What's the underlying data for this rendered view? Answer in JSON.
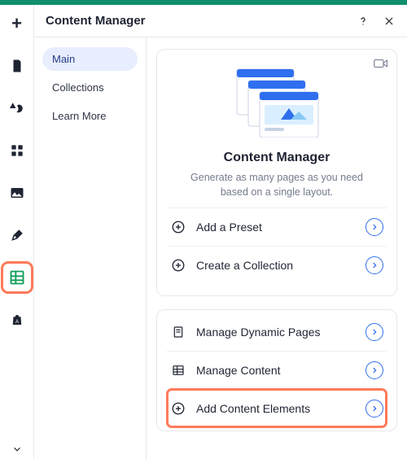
{
  "panel": {
    "title": "Content Manager",
    "subnav": [
      {
        "label": "Main",
        "active": true
      },
      {
        "label": "Collections",
        "active": false
      },
      {
        "label": "Learn More",
        "active": false
      }
    ]
  },
  "hero": {
    "title": "Content Manager",
    "subtitle": "Generate as many pages as you need based on a single layout."
  },
  "actions_primary": [
    {
      "label": "Add a Preset"
    },
    {
      "label": "Create a Collection"
    }
  ],
  "actions_secondary": [
    {
      "label": "Manage Dynamic Pages"
    },
    {
      "label": "Manage Content"
    },
    {
      "label": "Add Content Elements",
      "highlighted": true
    }
  ]
}
